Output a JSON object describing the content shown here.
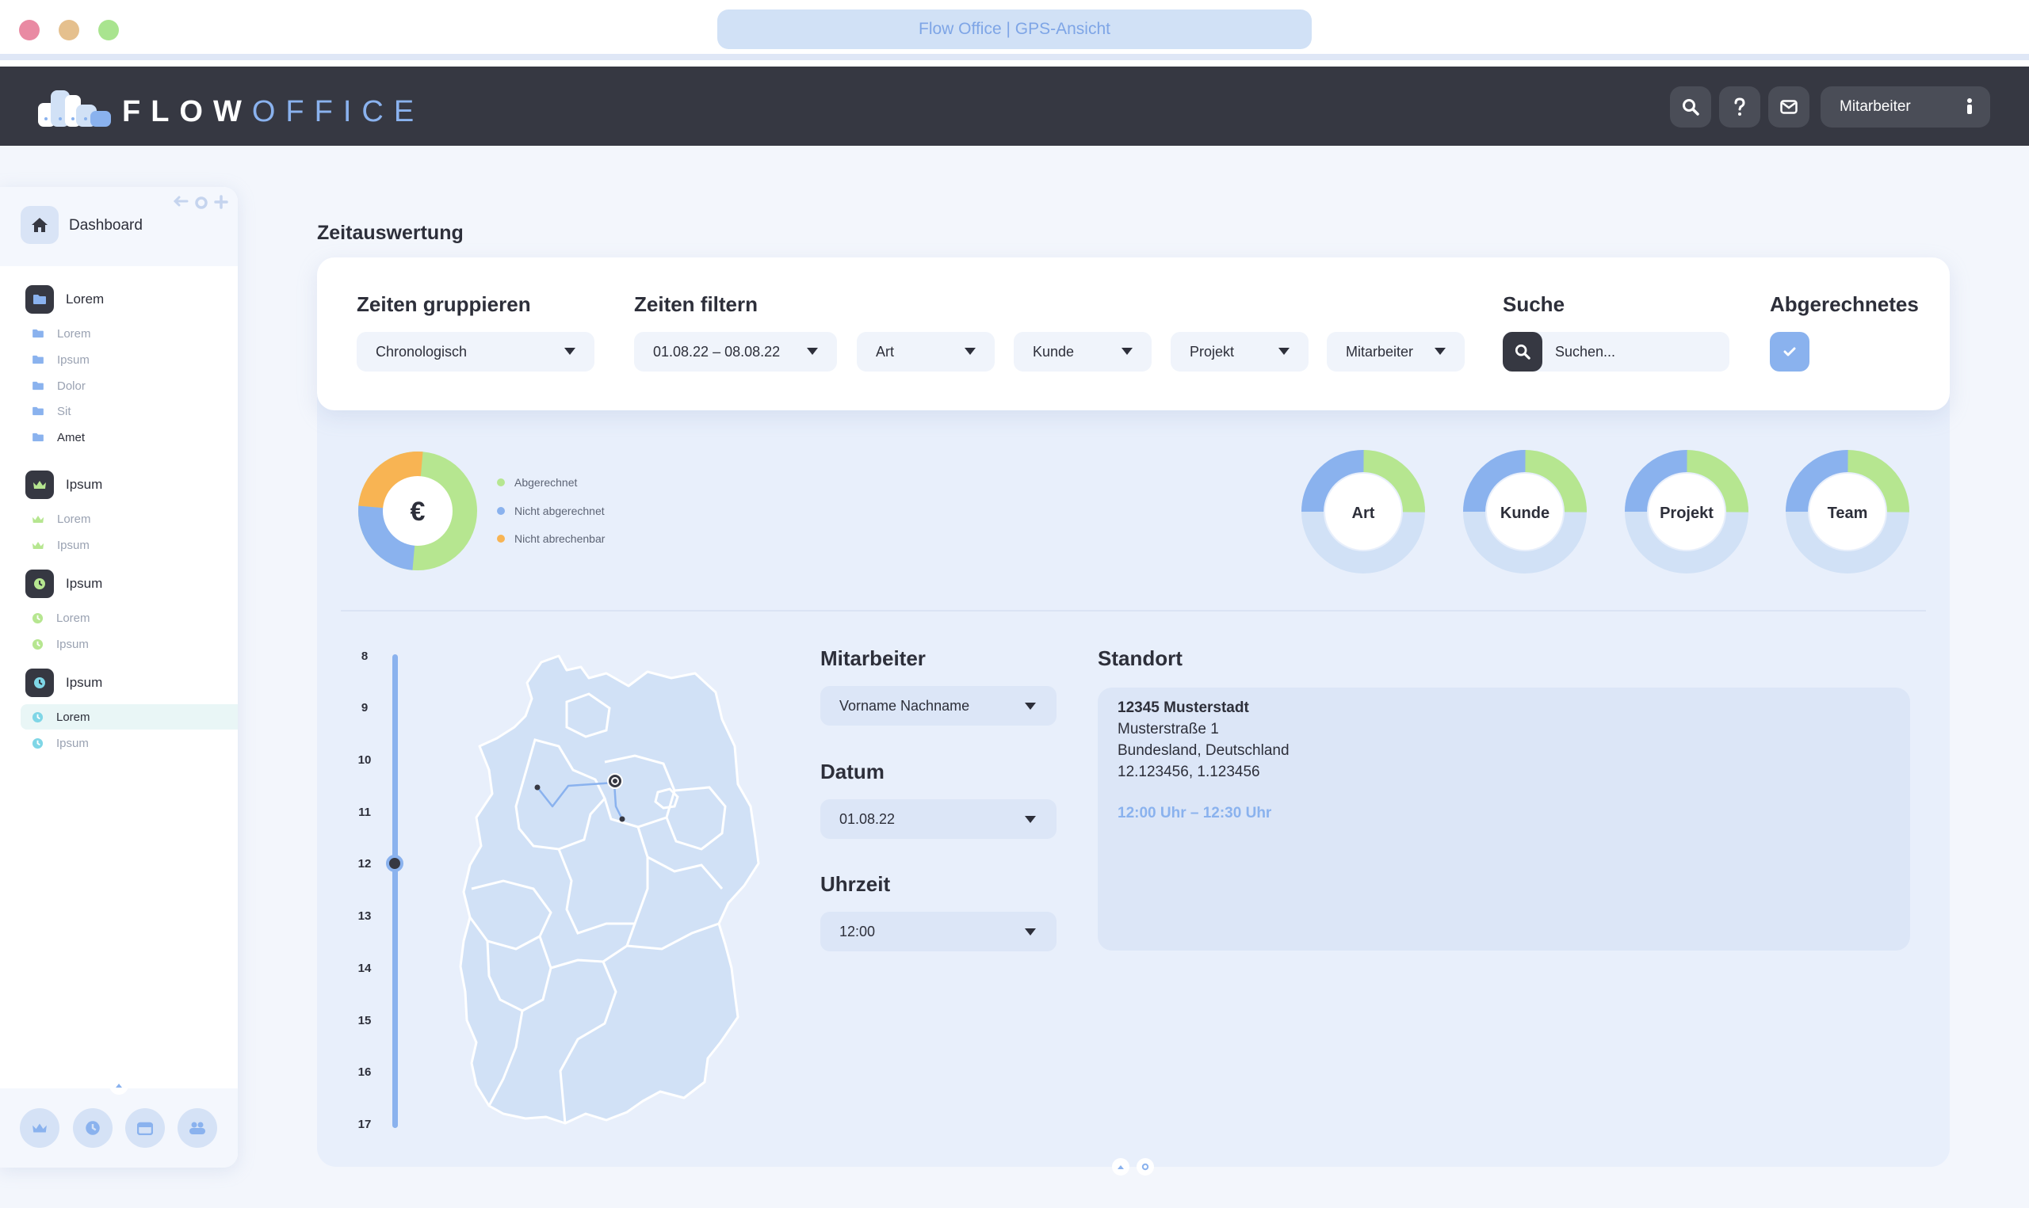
{
  "window": {
    "title": "Flow Office | GPS-Ansicht"
  },
  "brand": {
    "name_bold": "FLOW",
    "name_light": "OFFICE"
  },
  "header": {
    "user_label": "Mitarbeiter"
  },
  "sidebar": {
    "dashboard_label": "Dashboard",
    "groups": [
      {
        "label": "Lorem",
        "icon": "folder-icon",
        "items": [
          "Lorem",
          "Ipsum",
          "Dolor",
          "Sit",
          "Amet"
        ]
      },
      {
        "label": "Ipsum",
        "icon": "crown-icon",
        "items": [
          "Lorem",
          "Ipsum"
        ]
      },
      {
        "label": "Ipsum",
        "icon": "clock-icon",
        "items": [
          "Lorem",
          "Ipsum"
        ]
      },
      {
        "label": "Ipsum",
        "icon": "clock-icon",
        "items": [
          "Lorem",
          "Ipsum"
        ]
      }
    ],
    "footer_icons": [
      "crown-icon",
      "clock-icon",
      "calendar-icon",
      "team-icon"
    ]
  },
  "page": {
    "title": "Zeitauswertung"
  },
  "filters": {
    "group_label": "Zeiten gruppieren",
    "group_value": "Chronologisch",
    "filter_label": "Zeiten filtern",
    "date_range": "01.08.22 – 08.08.22",
    "art": "Art",
    "kunde": "Kunde",
    "projekt": "Projekt",
    "mitarbeiter": "Mitarbeiter",
    "search_label": "Suche",
    "search_placeholder": "Suchen...",
    "billed_label": "Abgerechnetes"
  },
  "summary": {
    "currency_symbol": "€",
    "legend": [
      {
        "label": "Abgerechnet",
        "color": "#b6e690"
      },
      {
        "label": "Nicht abgerechnet",
        "color": "#8ab2ee"
      },
      {
        "label": "Nicht abrechenbar",
        "color": "#f8b453"
      }
    ],
    "donuts": [
      "Art",
      "Kunde",
      "Projekt",
      "Team"
    ]
  },
  "timeline": {
    "hours": [
      "8",
      "9",
      "10",
      "11",
      "12",
      "13",
      "14",
      "15",
      "16",
      "17"
    ],
    "selected": "12"
  },
  "details": {
    "employee_label": "Mitarbeiter",
    "employee_value": "Vorname Nachname",
    "date_label": "Datum",
    "date_value": "01.08.22",
    "time_label": "Uhrzeit",
    "time_value": "12:00",
    "location_label": "Standort",
    "location": {
      "city": "12345 Musterstadt",
      "street": "Musterstraße 1",
      "region": "Bundesland, Deutschland",
      "coords": "12.123456, 1.123456",
      "time_span": "12:00 Uhr – 12:30 Uhr"
    }
  },
  "colors": {
    "dark": "#363842",
    "accent": "#8ab2ee",
    "green": "#b6e690",
    "orange": "#f8b453",
    "light_blue": "#d1e1f6"
  }
}
